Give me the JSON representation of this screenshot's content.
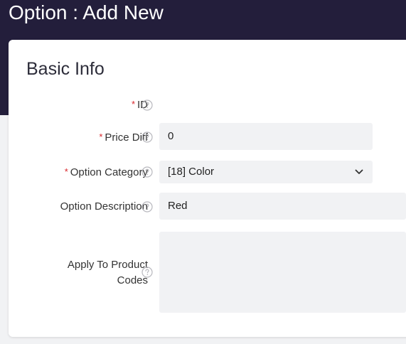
{
  "header": {
    "title": "Option : Add New"
  },
  "form": {
    "section_title": "Basic Info",
    "required_mark": "*",
    "fields": {
      "id": {
        "label": "ID",
        "value": ""
      },
      "price_diff": {
        "label": "Price Diff",
        "value": "0"
      },
      "option_category": {
        "label": "Option Category",
        "value": "[18] Color"
      },
      "option_description": {
        "label": "Option Description",
        "value": "Red"
      },
      "apply_to_product_codes": {
        "label": "Apply To Product Codes",
        "value": ""
      }
    }
  },
  "icons": {
    "help": "question-circle-icon",
    "dropdown": "chevron-down-icon"
  },
  "colors": {
    "header_bg": "#231e3b",
    "required": "#d9262b",
    "field_bg": "#f1f2f4"
  }
}
